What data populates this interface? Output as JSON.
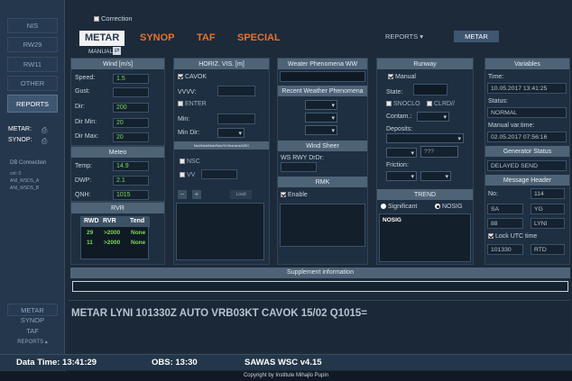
{
  "sidebar": {
    "nav": [
      "NIS",
      "RW29",
      "RW11",
      "OTHER",
      "REPORTS"
    ],
    "metar_label": "METAR:",
    "synop_label": "SYNOP:",
    "db_title": "DB Connection",
    "db_lines": [
      "cnt: 0",
      "ANI_WSDS_A",
      "ANI_WSDS_B"
    ],
    "bottom_nav": [
      "METAR",
      "SYNOP",
      "TAF",
      "REPORTS ▴"
    ]
  },
  "top": {
    "correction_label": "Correction",
    "tabs": [
      "METAR",
      "SYNOP",
      "TAF",
      "SPECIAL"
    ],
    "manual_label": "MANUAL",
    "reports_label": "REPORTS ▾",
    "metar_btn": "METAR"
  },
  "wind": {
    "title": "Wind [m/s]",
    "rows": [
      {
        "label": "Speed:",
        "value": "1.5"
      },
      {
        "label": "Gust:",
        "value": ""
      },
      {
        "label": "Dir:",
        "value": "200"
      },
      {
        "label": "Dir Min:",
        "value": "20"
      },
      {
        "label": "Dir Max:",
        "value": "20"
      }
    ]
  },
  "meteo": {
    "title": "Meteo",
    "rows": [
      {
        "label": "Temp:",
        "value": "14.9"
      },
      {
        "label": "DWP:",
        "value": "2.1"
      },
      {
        "label": "QNH:",
        "value": "1015"
      }
    ]
  },
  "rvr": {
    "title": "RVR",
    "headers": [
      "RWD",
      "RVR",
      "Tend"
    ],
    "rows": [
      [
        "29",
        ">2000",
        "None"
      ],
      [
        "11",
        ">2000",
        "None"
      ]
    ]
  },
  "vis": {
    "title": "HORIZ. VIS. [m]",
    "cavok_label": "CAVOK",
    "vvvv_label": "VVVV:",
    "enter_label": "ENTER",
    "min_label": "Min:",
    "mindir_label": "Min Dir:",
    "cloud_header": "Nsh/Nsh/Nsh/Nsh/VV/hshshs/NSC",
    "nsc_label": "NSC",
    "vv_label": "VV",
    "minus_label": "−",
    "plus_label": "+",
    "load_label": "Load"
  },
  "weather": {
    "title": "Weater Phenomena WW",
    "recent_title": "Recent Weather Phenomena",
    "shear_title": "Wind Sheer",
    "ws_label": "WS RWY DrDr:",
    "rmk_title": "RMK",
    "enable_label": "Enable"
  },
  "runway": {
    "title": "Runway",
    "manual_label": "Manual",
    "state_label": "State:",
    "snoclo_label": "SNOCLO",
    "clrd_label": "CLRD//",
    "contam_label": "Contam.:",
    "deposits_label": "Deposits:",
    "qqq": "???",
    "friction_label": "Friction:"
  },
  "trend": {
    "title": "TREND",
    "significant_label": "Significant",
    "nosig_label": "NOSIG",
    "text": "NOSIG"
  },
  "variables": {
    "title": "Variables",
    "time_label": "Time:",
    "time_value": "10.05.2017 13:41:25",
    "status_label": "Status:",
    "status_value": "NORMAL",
    "manvar_label": "Manual var.time:",
    "manvar_value": "02.05.2017 07:56:16",
    "gen_title": "Generator Status",
    "gen_value": "DELAYED SEND",
    "msg_title": "Message Header",
    "no_label": "No:",
    "no_value": "114",
    "sa": "SA",
    "yg": "YG",
    "num88": "88",
    "lyni": "LYNI",
    "lock_label": "Lock UTC time",
    "t101330": "101330",
    "rtd": "RTD"
  },
  "supplement": {
    "title": "Supplement information"
  },
  "metar_text": "METAR LYNI 101330Z AUTO VRB03KT CAVOK 15/02 Q1015=",
  "status": {
    "data_time": "Data Time: 13:41:29",
    "obs": "OBS: 13:30",
    "version": "SAWAS WSC v4.15",
    "copyright": "Copyright by Institute Mihajlo Pupin"
  },
  "colors": {
    "accent_orange": "#e8712a",
    "value_green": "#7dd75a"
  }
}
